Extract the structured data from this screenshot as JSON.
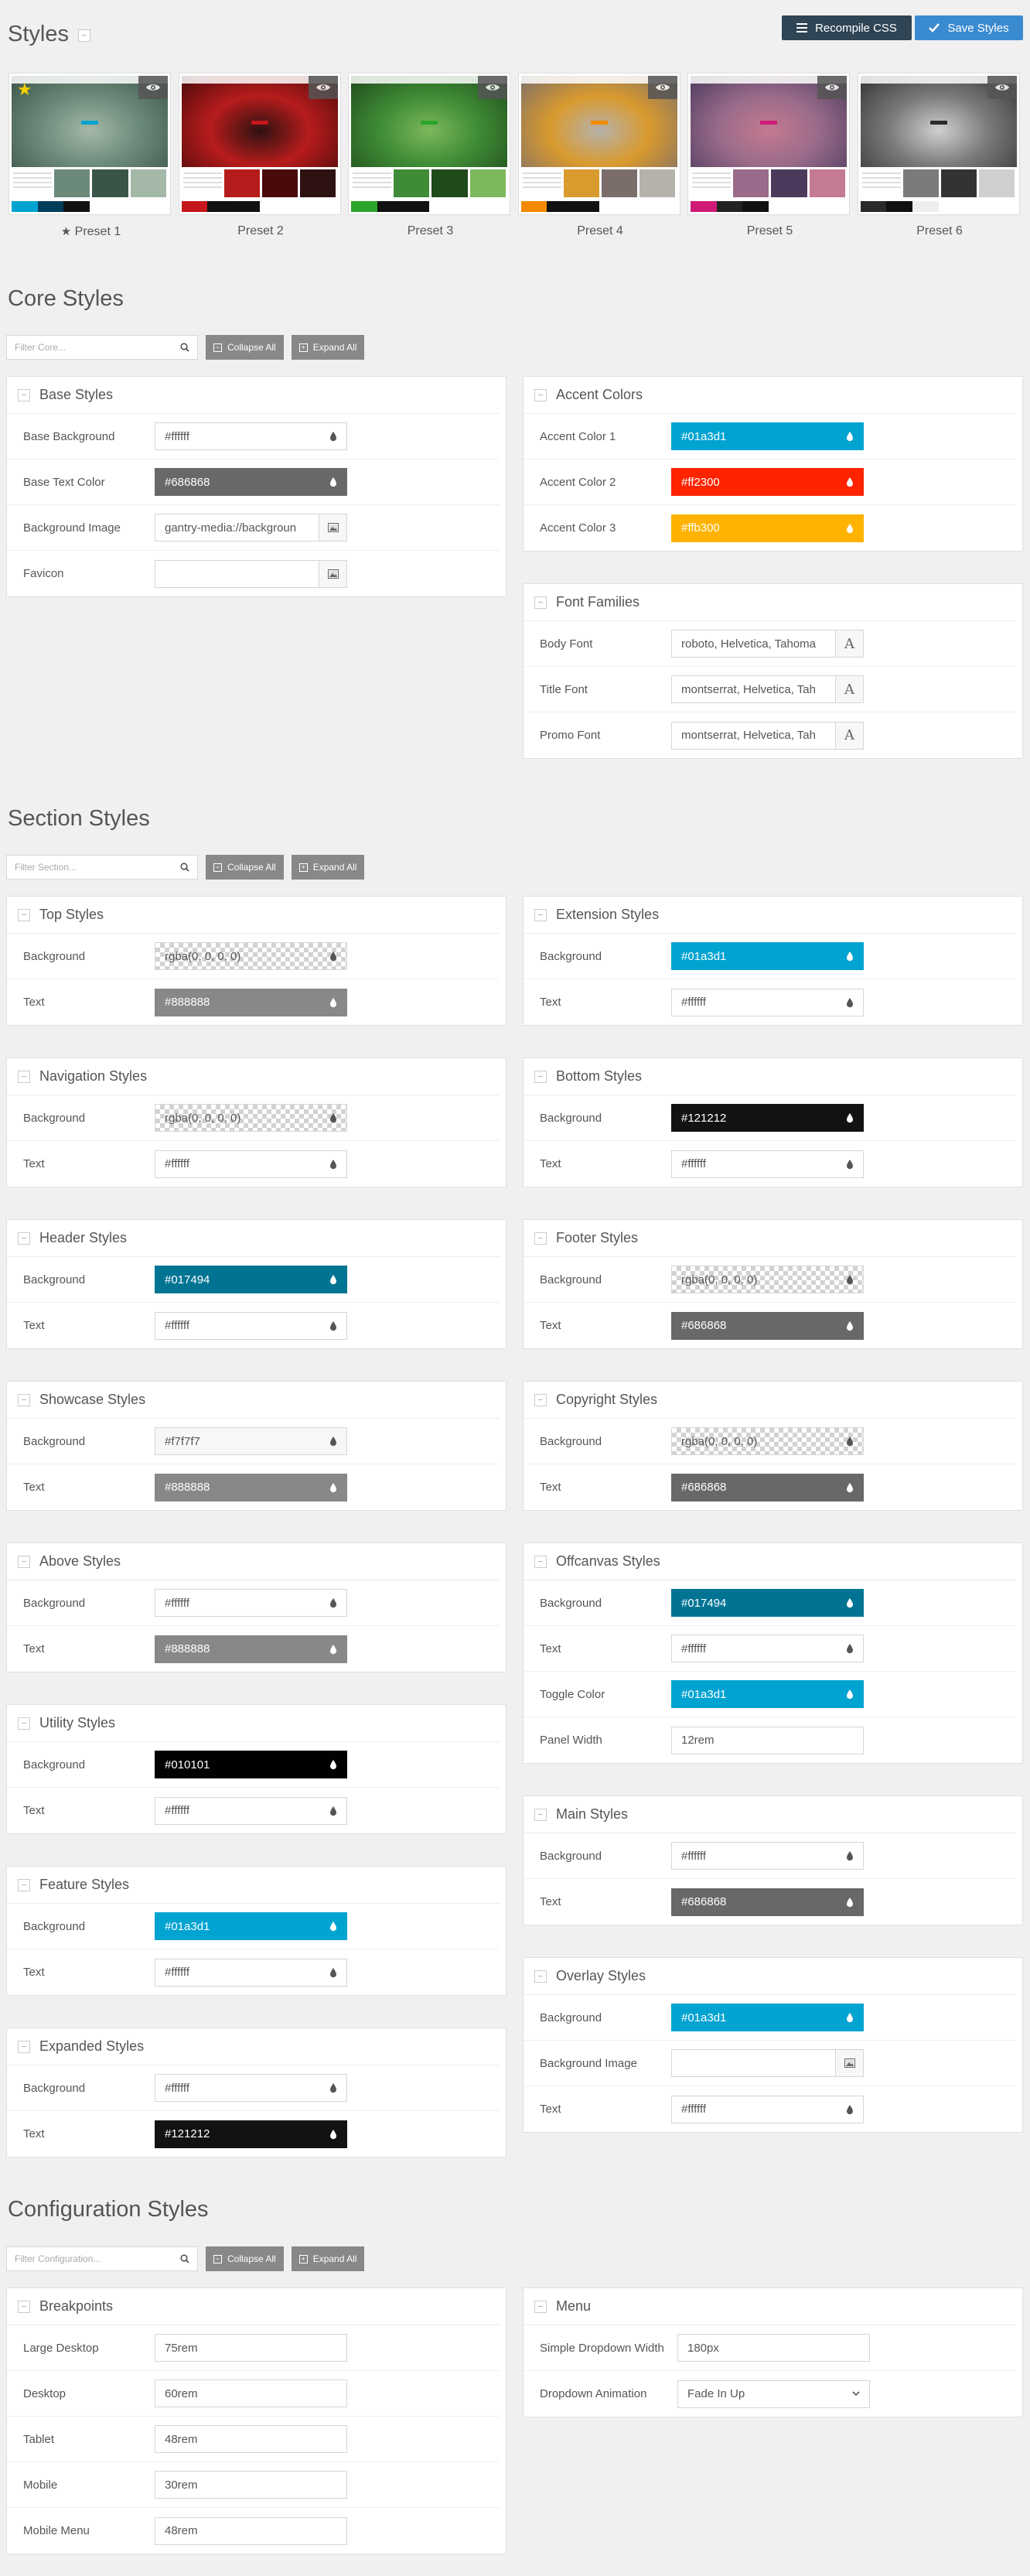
{
  "page": {
    "title": "Styles"
  },
  "toolbar": {
    "recompile_label": "Recompile CSS",
    "save_label": "Save Styles"
  },
  "presets": [
    {
      "label": "Preset 1",
      "active": true,
      "colors": [
        "#01a3d1",
        "#013e5a",
        "#121212"
      ],
      "image": [
        "#6c8a7a",
        "#3b5448",
        "#a4b8a8"
      ]
    },
    {
      "label": "Preset 2",
      "active": false,
      "colors": [
        "#c4161c",
        "#111111",
        "#121212"
      ],
      "image": [
        "#b71c1c",
        "#4a0a0a",
        "#2e1111"
      ]
    },
    {
      "label": "Preset 3",
      "active": false,
      "colors": [
        "#2aa52a",
        "#111111",
        "#121212"
      ],
      "image": [
        "#3f8b36",
        "#1f4a1a",
        "#7cb85c"
      ]
    },
    {
      "label": "Preset 4",
      "active": false,
      "colors": [
        "#f38b00",
        "#111111",
        "#121212"
      ],
      "image": [
        "#d99a2e",
        "#7b6e6a",
        "#b5b1ab"
      ]
    },
    {
      "label": "Preset 5",
      "active": false,
      "colors": [
        "#cf1b77",
        "#222222",
        "#121212"
      ],
      "image": [
        "#9a6b8a",
        "#4b3a5c",
        "#c47a90"
      ]
    },
    {
      "label": "Preset 6",
      "active": false,
      "colors": [
        "#2a2a2a",
        "#111111",
        "#eeeeee"
      ],
      "image": [
        "#7b7b7b",
        "#333333",
        "#cfcfcf"
      ]
    }
  ],
  "core": {
    "title": "Core Styles",
    "filter_placeholder": "Filter Core...",
    "collapse_label": "Collapse All",
    "expand_label": "Expand All",
    "base": {
      "title": "Base Styles",
      "rows": [
        {
          "label": "Base Background",
          "value": "#ffffff",
          "color": "#ffffff",
          "kind": "color"
        },
        {
          "label": "Base Text Color",
          "value": "#686868",
          "color": "#686868",
          "kind": "color"
        },
        {
          "label": "Background Image",
          "value": "gantry-media://backgroun",
          "kind": "image"
        },
        {
          "label": "Favicon",
          "value": "",
          "kind": "image"
        }
      ]
    },
    "accent": {
      "title": "Accent Colors",
      "rows": [
        {
          "label": "Accent Color 1",
          "value": "#01a3d1",
          "color": "#01a3d1",
          "kind": "color"
        },
        {
          "label": "Accent Color 2",
          "value": "#ff2300",
          "color": "#ff2300",
          "kind": "color"
        },
        {
          "label": "Accent Color 3",
          "value": "#ffb300",
          "color": "#ffb300",
          "kind": "color"
        }
      ]
    },
    "fonts": {
      "title": "Font Families",
      "rows": [
        {
          "label": "Body Font",
          "value": "roboto, Helvetica, Tahoma",
          "kind": "font"
        },
        {
          "label": "Title Font",
          "value": "montserrat, Helvetica, Tah",
          "kind": "font"
        },
        {
          "label": "Promo Font",
          "value": "montserrat, Helvetica, Tah",
          "kind": "font"
        }
      ]
    }
  },
  "section": {
    "title": "Section Styles",
    "filter_placeholder": "Filter Section...",
    "collapse_label": "Collapse All",
    "expand_label": "Expand All",
    "top": {
      "title": "Top Styles",
      "rows": [
        {
          "label": "Background",
          "value": "rgba(0, 0, 0, 0)",
          "color": "transparent",
          "kind": "color"
        },
        {
          "label": "Text",
          "value": "#888888",
          "color": "#888888",
          "kind": "color"
        }
      ]
    },
    "navigation": {
      "title": "Navigation Styles",
      "rows": [
        {
          "label": "Background",
          "value": "rgba(0, 0, 0, 0)",
          "color": "transparent",
          "kind": "color"
        },
        {
          "label": "Text",
          "value": "#ffffff",
          "color": "#ffffff",
          "kind": "color"
        }
      ]
    },
    "header": {
      "title": "Header Styles",
      "rows": [
        {
          "label": "Background",
          "value": "#017494",
          "color": "#017494",
          "kind": "color"
        },
        {
          "label": "Text",
          "value": "#ffffff",
          "color": "#ffffff",
          "kind": "color"
        }
      ]
    },
    "showcase": {
      "title": "Showcase Styles",
      "rows": [
        {
          "label": "Background",
          "value": "#f7f7f7",
          "color": "#f7f7f7",
          "kind": "color"
        },
        {
          "label": "Text",
          "value": "#888888",
          "color": "#888888",
          "kind": "color"
        }
      ]
    },
    "above": {
      "title": "Above Styles",
      "rows": [
        {
          "label": "Background",
          "value": "#ffffff",
          "color": "#ffffff",
          "kind": "color"
        },
        {
          "label": "Text",
          "value": "#888888",
          "color": "#888888",
          "kind": "color"
        }
      ]
    },
    "utility": {
      "title": "Utility Styles",
      "rows": [
        {
          "label": "Background",
          "value": "#010101",
          "color": "#010101",
          "kind": "color"
        },
        {
          "label": "Text",
          "value": "#ffffff",
          "color": "#ffffff",
          "kind": "color"
        }
      ]
    },
    "feature": {
      "title": "Feature Styles",
      "rows": [
        {
          "label": "Background",
          "value": "#01a3d1",
          "color": "#01a3d1",
          "kind": "color"
        },
        {
          "label": "Text",
          "value": "#ffffff",
          "color": "#ffffff",
          "kind": "color"
        }
      ]
    },
    "expanded": {
      "title": "Expanded Styles",
      "rows": [
        {
          "label": "Background",
          "value": "#ffffff",
          "color": "#ffffff",
          "kind": "color"
        },
        {
          "label": "Text",
          "value": "#121212",
          "color": "#121212",
          "kind": "color"
        }
      ]
    },
    "extension": {
      "title": "Extension Styles",
      "rows": [
        {
          "label": "Background",
          "value": "#01a3d1",
          "color": "#01a3d1",
          "kind": "color"
        },
        {
          "label": "Text",
          "value": "#ffffff",
          "color": "#ffffff",
          "kind": "color"
        }
      ]
    },
    "bottom": {
      "title": "Bottom Styles",
      "rows": [
        {
          "label": "Background",
          "value": "#121212",
          "color": "#121212",
          "kind": "color"
        },
        {
          "label": "Text",
          "value": "#ffffff",
          "color": "#ffffff",
          "kind": "color"
        }
      ]
    },
    "footer": {
      "title": "Footer Styles",
      "rows": [
        {
          "label": "Background",
          "value": "rgba(0, 0, 0, 0)",
          "color": "transparent",
          "kind": "color"
        },
        {
          "label": "Text",
          "value": "#686868",
          "color": "#686868",
          "kind": "color"
        }
      ]
    },
    "copyright": {
      "title": "Copyright Styles",
      "rows": [
        {
          "label": "Background",
          "value": "rgba(0, 0, 0, 0)",
          "color": "transparent",
          "kind": "color"
        },
        {
          "label": "Text",
          "value": "#686868",
          "color": "#686868",
          "kind": "color"
        }
      ]
    },
    "offcanvas": {
      "title": "Offcanvas Styles",
      "rows": [
        {
          "label": "Background",
          "value": "#017494",
          "color": "#017494",
          "kind": "color"
        },
        {
          "label": "Text",
          "value": "#ffffff",
          "color": "#ffffff",
          "kind": "color"
        },
        {
          "label": "Toggle Color",
          "value": "#01a3d1",
          "color": "#01a3d1",
          "kind": "color"
        },
        {
          "label": "Panel Width",
          "value": "12rem",
          "kind": "text"
        }
      ]
    },
    "main": {
      "title": "Main Styles",
      "rows": [
        {
          "label": "Background",
          "value": "#ffffff",
          "color": "#ffffff",
          "kind": "color"
        },
        {
          "label": "Text",
          "value": "#686868",
          "color": "#686868",
          "kind": "color"
        }
      ]
    },
    "overlay": {
      "title": "Overlay Styles",
      "rows": [
        {
          "label": "Background",
          "value": "#01a3d1",
          "color": "#01a3d1",
          "kind": "color"
        },
        {
          "label": "Background Image",
          "value": "",
          "kind": "image"
        },
        {
          "label": "Text",
          "value": "#ffffff",
          "color": "#ffffff",
          "kind": "color"
        }
      ]
    }
  },
  "config": {
    "title": "Configuration Styles",
    "filter_placeholder": "Filter Configuration...",
    "collapse_label": "Collapse All",
    "expand_label": "Expand All",
    "breakpoints": {
      "title": "Breakpoints",
      "rows": [
        {
          "label": "Large Desktop",
          "value": "75rem",
          "kind": "text"
        },
        {
          "label": "Desktop",
          "value": "60rem",
          "kind": "text"
        },
        {
          "label": "Tablet",
          "value": "48rem",
          "kind": "text"
        },
        {
          "label": "Mobile",
          "value": "30rem",
          "kind": "text"
        },
        {
          "label": "Mobile Menu",
          "value": "48rem",
          "kind": "text"
        }
      ]
    },
    "menu": {
      "title": "Menu",
      "rows": [
        {
          "label": "Simple Dropdown Width",
          "value": "180px",
          "kind": "text"
        },
        {
          "label": "Dropdown Animation",
          "value": "Fade In Up",
          "kind": "select"
        }
      ]
    }
  }
}
